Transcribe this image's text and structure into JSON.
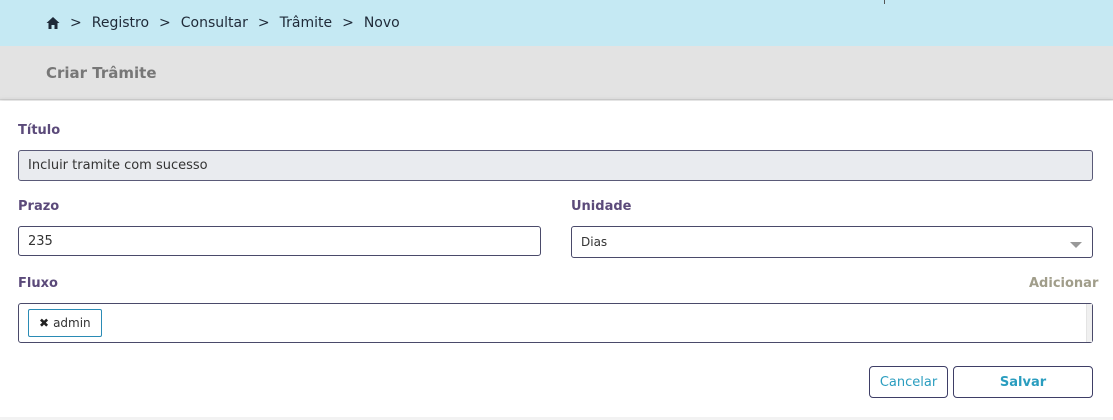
{
  "breadcrumb": {
    "items": [
      "Registro",
      "Consultar",
      "Trâmite",
      "Novo"
    ],
    "separator": ">"
  },
  "header": {
    "title": "Criar Trâmite"
  },
  "form": {
    "titulo_label": "Título",
    "titulo_value": "Incluir tramite com sucesso",
    "prazo_label": "Prazo",
    "prazo_value": "235",
    "unidade_label": "Unidade",
    "unidade_value": "Dias",
    "fluxo_label": "Fluxo",
    "adicionar_label": "Adicionar",
    "fluxo_tags": [
      "admin"
    ],
    "tag_remove_glyph": "✖"
  },
  "buttons": {
    "cancel_label": "Cancelar",
    "save_label": "Salvar"
  },
  "colors": {
    "breadcrumb_bg": "#c5e9f3",
    "label": "#5b4a7a",
    "accent": "#2a9dbf"
  }
}
